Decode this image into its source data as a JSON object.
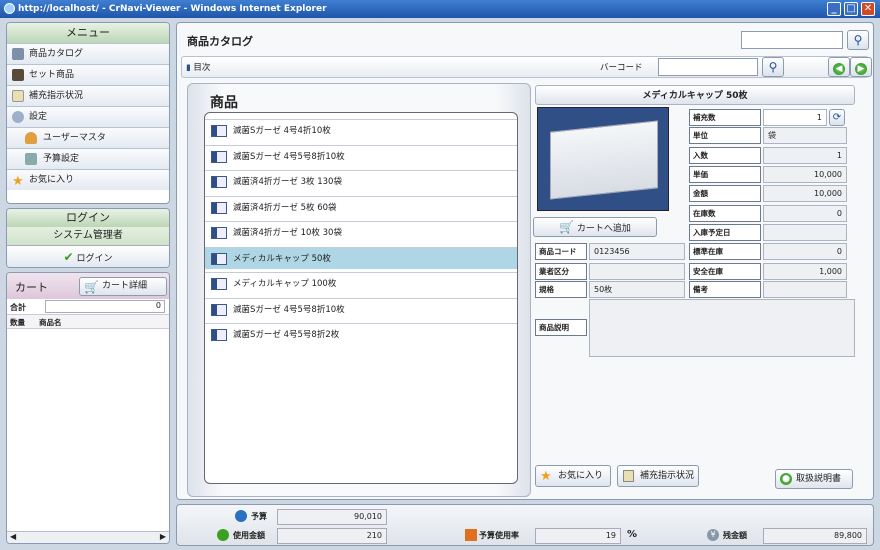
{
  "window": {
    "title": "http://localhost/ - CrNavi-Viewer - Windows Internet Explorer"
  },
  "menu": {
    "header": "メニュー",
    "items": [
      {
        "label": "商品カタログ",
        "icon": "catalog-icon"
      },
      {
        "label": "セット商品",
        "icon": "set-product-icon"
      },
      {
        "label": "補充指示状況",
        "icon": "replenish-icon"
      },
      {
        "label": "設定",
        "icon": "settings-icon"
      },
      {
        "label": "ユーザーマスタ",
        "icon": "user-icon"
      },
      {
        "label": "予算設定",
        "icon": "budget-icon"
      },
      {
        "label": "お気に入り",
        "icon": "star-icon"
      }
    ]
  },
  "login": {
    "header": "ログイン",
    "user": "システム管理者",
    "button": "ログイン"
  },
  "cart": {
    "tab": "カート",
    "detail_button": "カート詳細",
    "total_label": "合計",
    "total_value": "0",
    "col_qty": "数量",
    "col_name": "商品名"
  },
  "main": {
    "title": "商品カタログ",
    "search_value": "",
    "toc_label": "目次",
    "barcode_label": "バーコード",
    "barcode_value": ""
  },
  "list": {
    "header": "商品",
    "items": [
      {
        "label": "滅菌Sガーゼ 4号4折10枚",
        "selected": false
      },
      {
        "label": "滅菌Sガーゼ 4号5号8折10枚",
        "selected": false
      },
      {
        "label": "滅菌済4折ガーゼ 3枚 130袋",
        "selected": false
      },
      {
        "label": "滅菌済4折ガーゼ 5枚 60袋",
        "selected": false
      },
      {
        "label": "滅菌済4折ガーゼ 10枚 30袋",
        "selected": false
      },
      {
        "label": "メディカルキャップ 50枚",
        "selected": true
      },
      {
        "label": "メディカルキャップ 100枚",
        "selected": false
      },
      {
        "label": "滅菌Sガーゼ 4号5号8折10枚",
        "selected": false
      },
      {
        "label": "滅菌Sガーゼ 4号5号8折2枚",
        "selected": false
      }
    ]
  },
  "detail": {
    "title": "メディカルキャップ 50枚",
    "add_cart": "カートへ追加",
    "fields": {
      "qty": {
        "label": "補充数",
        "value": "1"
      },
      "unit": {
        "label": "単位",
        "value": "袋"
      },
      "entry": {
        "label": "入数",
        "value": "1"
      },
      "price": {
        "label": "単価",
        "value": "10,000"
      },
      "amount": {
        "label": "金額",
        "value": "10,000"
      },
      "order_limit": {
        "label": "在庫数",
        "value": "0"
      },
      "inbound": {
        "label": "入庫予定日",
        "value": ""
      },
      "code": {
        "label": "商品コード",
        "value": "0123456"
      },
      "min_stock": {
        "label": "標準在庫",
        "value": "0"
      },
      "supplier": {
        "label": "業者区分",
        "value": ""
      },
      "safety": {
        "label": "安全在庫",
        "value": "1,000"
      },
      "spec": {
        "label": "規格",
        "value": "50枚"
      },
      "note": {
        "label": "備考",
        "value": ""
      },
      "desc": {
        "label": "商品説明",
        "value": ""
      }
    },
    "fav_button": "お気に入り",
    "replenish_button": "補充指示状況",
    "manual_button": "取扱説明書"
  },
  "footer": {
    "budget_label": "予算",
    "budget_value": "90,010",
    "used_label": "使用金額",
    "used_value": "210",
    "rate_label": "予算使用率",
    "rate_value": "19",
    "rate_unit": "%",
    "remain_label": "残金額",
    "remain_value": "89,800"
  }
}
